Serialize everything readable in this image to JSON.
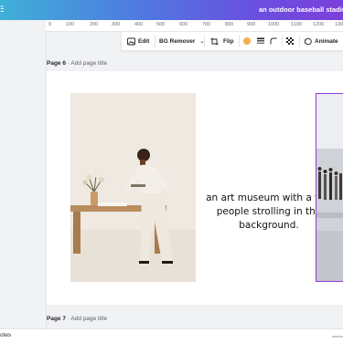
{
  "header": {
    "document_title": "an outdoor baseball stadium with"
  },
  "ruler": {
    "ticks": [
      "0",
      "100",
      "200",
      "300",
      "400",
      "500",
      "600",
      "700",
      "800",
      "900",
      "1000",
      "1100",
      "1200",
      "1300"
    ]
  },
  "toolbar": {
    "edit_label": "Edit",
    "bg_remover_label": "BG Remover",
    "flip_label": "Flip",
    "animate_label": "Animate",
    "swatch_color": "#f4b04f"
  },
  "pages": [
    {
      "number_label": "Page 6",
      "title_placeholder": "Add page title"
    },
    {
      "number_label": "Page 7",
      "title_placeholder": "Add page title"
    }
  ],
  "canvas": {
    "caption": "an art museum with a few people strolling in the background."
  },
  "footer": {
    "notes_label": "otes"
  },
  "colors": {
    "selection": "#8b3fd8",
    "header_gradient": [
      "#3fb0d8",
      "#7c3fdc"
    ]
  }
}
